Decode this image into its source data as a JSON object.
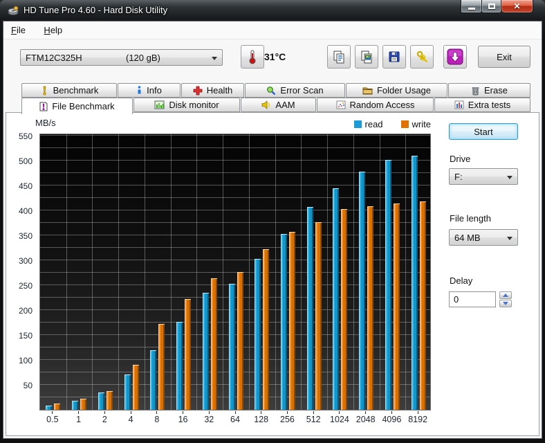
{
  "window": {
    "title": "HD Tune Pro 4.60 - Hard Disk Utility"
  },
  "menu": {
    "items": [
      {
        "label": "File"
      },
      {
        "label": "Help"
      }
    ]
  },
  "toolbar": {
    "drive_name": "FTM12C325H",
    "drive_size": "(120 gB)",
    "temperature": "31°C",
    "buttons": [
      "copy-text",
      "copy-image",
      "save",
      "options",
      "update"
    ],
    "exit_label": "Exit"
  },
  "tabs": {
    "row1": [
      {
        "label": "Benchmark"
      },
      {
        "label": "Info"
      },
      {
        "label": "Health"
      },
      {
        "label": "Error Scan"
      },
      {
        "label": "Folder Usage"
      },
      {
        "label": "Erase"
      }
    ],
    "row2": [
      {
        "label": "File Benchmark"
      },
      {
        "label": "Disk monitor"
      },
      {
        "label": "AAM"
      },
      {
        "label": "Random Access"
      },
      {
        "label": "Extra tests"
      }
    ],
    "active": "File Benchmark"
  },
  "panel": {
    "start_label": "Start",
    "drive_label": "Drive",
    "drive_value": "F:",
    "file_length_label": "File length",
    "file_length_value": "64 MB",
    "delay_label": "Delay",
    "delay_value": "0"
  },
  "chart_data": {
    "type": "bar",
    "title": "File Benchmark",
    "ylabel": "MB/s",
    "categories": [
      "0.5",
      "1",
      "2",
      "4",
      "8",
      "16",
      "32",
      "64",
      "128",
      "256",
      "512",
      "1024",
      "2048",
      "4096",
      "8192"
    ],
    "series": [
      {
        "name": "read",
        "color": "#1b9cd6",
        "values": [
          8,
          18,
          35,
          71,
          119,
          176,
          235,
          253,
          303,
          353,
          407,
          445,
          478,
          502,
          510
        ]
      },
      {
        "name": "write",
        "color": "#e07300",
        "values": [
          12,
          22,
          37,
          90,
          172,
          222,
          264,
          277,
          322,
          357,
          376,
          403,
          408,
          414,
          418
        ]
      }
    ],
    "ylim": [
      0,
      550
    ],
    "ytick_step": 50,
    "grid_step": 25,
    "grid": true,
    "legend_position": "top-right"
  }
}
